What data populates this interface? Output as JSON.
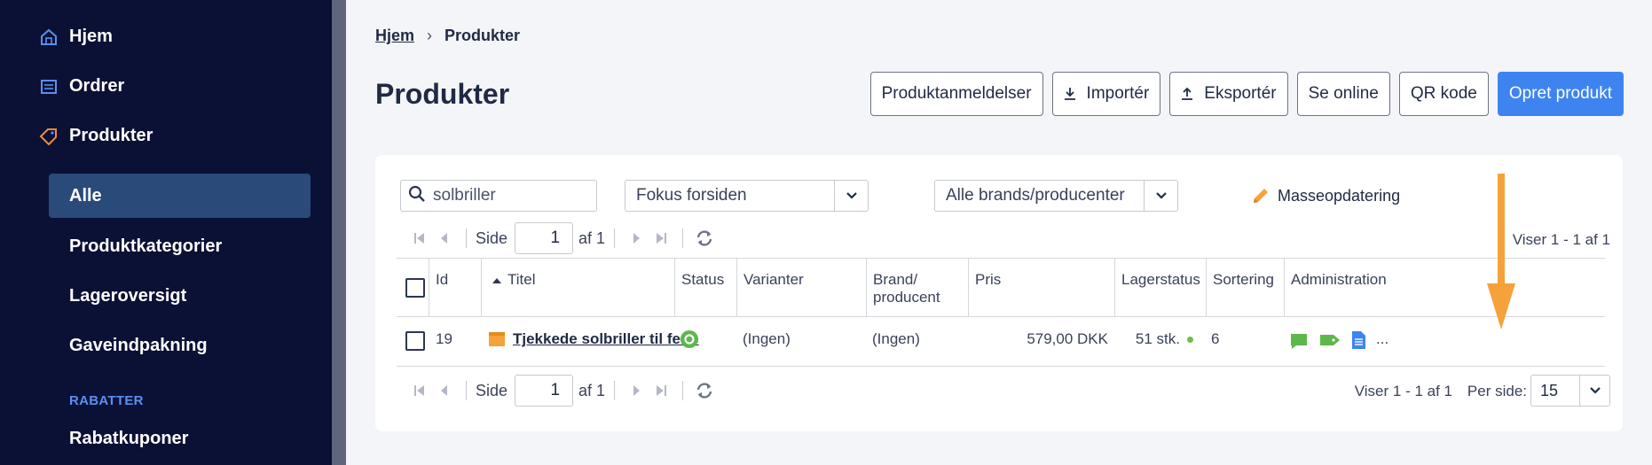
{
  "sidebar": {
    "items": [
      {
        "label": "Hjem",
        "icon": "home-icon"
      },
      {
        "label": "Ordrer",
        "icon": "orders-icon"
      },
      {
        "label": "Produkter",
        "icon": "tag-icon"
      }
    ],
    "sub_items": [
      {
        "label": "Alle",
        "active": true
      },
      {
        "label": "Produktkategorier"
      },
      {
        "label": "Lageroversigt"
      },
      {
        "label": "Gaveindpakning"
      }
    ],
    "section_title": "RABATTER",
    "section_items": [
      {
        "label": "Rabatkuponer"
      }
    ]
  },
  "breadcrumb": {
    "home": "Hjem",
    "current": "Produkter"
  },
  "page_title": "Produkter",
  "actions": {
    "reviews": "Produktanmeldelser",
    "import": "Importér",
    "export": "Eksportér",
    "online": "Se online",
    "qr": "QR kode",
    "create": "Opret produkt"
  },
  "filters": {
    "search_value": "solbriller",
    "focus_select": "Fokus forsiden",
    "brand_select": "Alle brands/producenter",
    "mass_update": "Masseopdatering"
  },
  "pager": {
    "side_label": "Side",
    "page": "1",
    "of_label": "af 1",
    "info": "Viser 1 - 1 af 1",
    "per_page_label": "Per side:",
    "per_page_value": "15"
  },
  "table": {
    "columns": [
      "Id",
      "Titel",
      "Status",
      "Varianter",
      "Brand/ producent",
      "Pris",
      "Lagerstatus",
      "Sortering",
      "Administration"
    ],
    "rows": [
      {
        "id": "19",
        "title": "Tjekkede solbriller til ferie",
        "variants": "(Ingen)",
        "brand": "(Ingen)",
        "price": "579,00 DKK",
        "stock": "51 stk.",
        "sort": "6",
        "more": "..."
      }
    ]
  },
  "colors": {
    "sidebar_bg": "#0b1135",
    "active_bg": "#2a4a7a",
    "primary": "#3e84f0",
    "success": "#6cc04a",
    "annotation_arrow": "#f5a23a"
  }
}
